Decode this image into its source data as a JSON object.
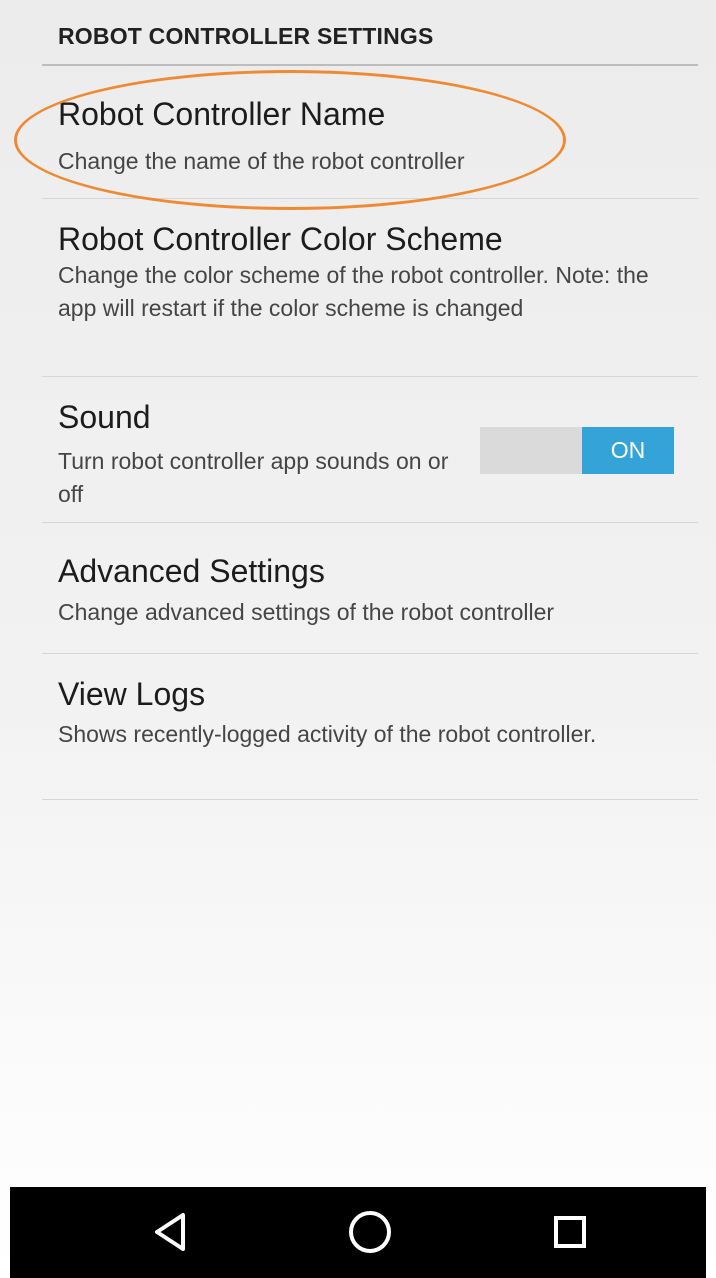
{
  "header": {
    "title": "ROBOT CONTROLLER SETTINGS"
  },
  "preferences": {
    "name": {
      "title": "Robot Controller Name",
      "summary": "Change the name of the robot controller"
    },
    "color_scheme": {
      "title": "Robot Controller Color Scheme",
      "summary": "Change the color scheme of the robot controller. Note: the app will restart if the color scheme is changed"
    },
    "sound": {
      "title": "Sound",
      "summary": "Turn robot controller app sounds on or off",
      "toggle_label": "ON"
    },
    "advanced": {
      "title": "Advanced Settings",
      "summary": "Change advanced settings of the robot controller"
    },
    "logs": {
      "title": "View Logs",
      "summary": "Shows recently-logged activity of the robot controller."
    }
  },
  "navbar": {
    "back_icon": "triangle-back-icon",
    "home_icon": "circle-home-icon",
    "recents_icon": "square-recents-icon"
  },
  "colors": {
    "accent": "#33a3d8",
    "highlight": "#ef8a32",
    "navbar": "#000000"
  }
}
